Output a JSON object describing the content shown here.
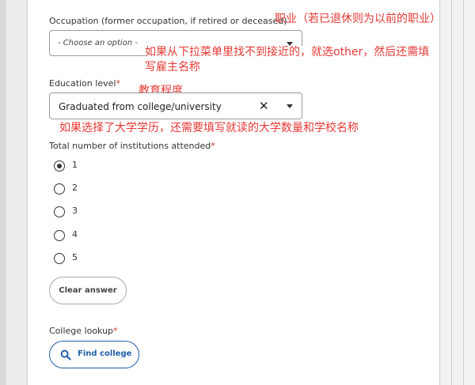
{
  "occupation": {
    "label": "Occupation (former occupation, if retired or deceased)",
    "placeholder": "- Choose an option -",
    "annotation": "职业（若已退休则为以前的职业）",
    "help_annotation_line1": "如果从下拉菜单里找不到接近的，就选other，然后还需填",
    "help_annotation_line2": "写雇主名称"
  },
  "education": {
    "label": "Education level",
    "required_mark": "*",
    "annotation": "教育程度",
    "value": "Graduated from college/university",
    "clear_symbol": "✕",
    "help_annotation": "如果选择了大学学历，还需要填写就读的大学数量和学校名称"
  },
  "institutions": {
    "label": "Total number of institutions attended",
    "required_mark": "*",
    "options": [
      "1",
      "2",
      "3",
      "4",
      "5"
    ],
    "selected": "1",
    "clear_button": "Clear answer"
  },
  "college_lookup": {
    "label": "College lookup",
    "required_mark": "*",
    "button": "Find college",
    "button_icon": "search-icon"
  },
  "colors": {
    "annotation": "#e53935",
    "link_blue": "#1f5fa8"
  }
}
